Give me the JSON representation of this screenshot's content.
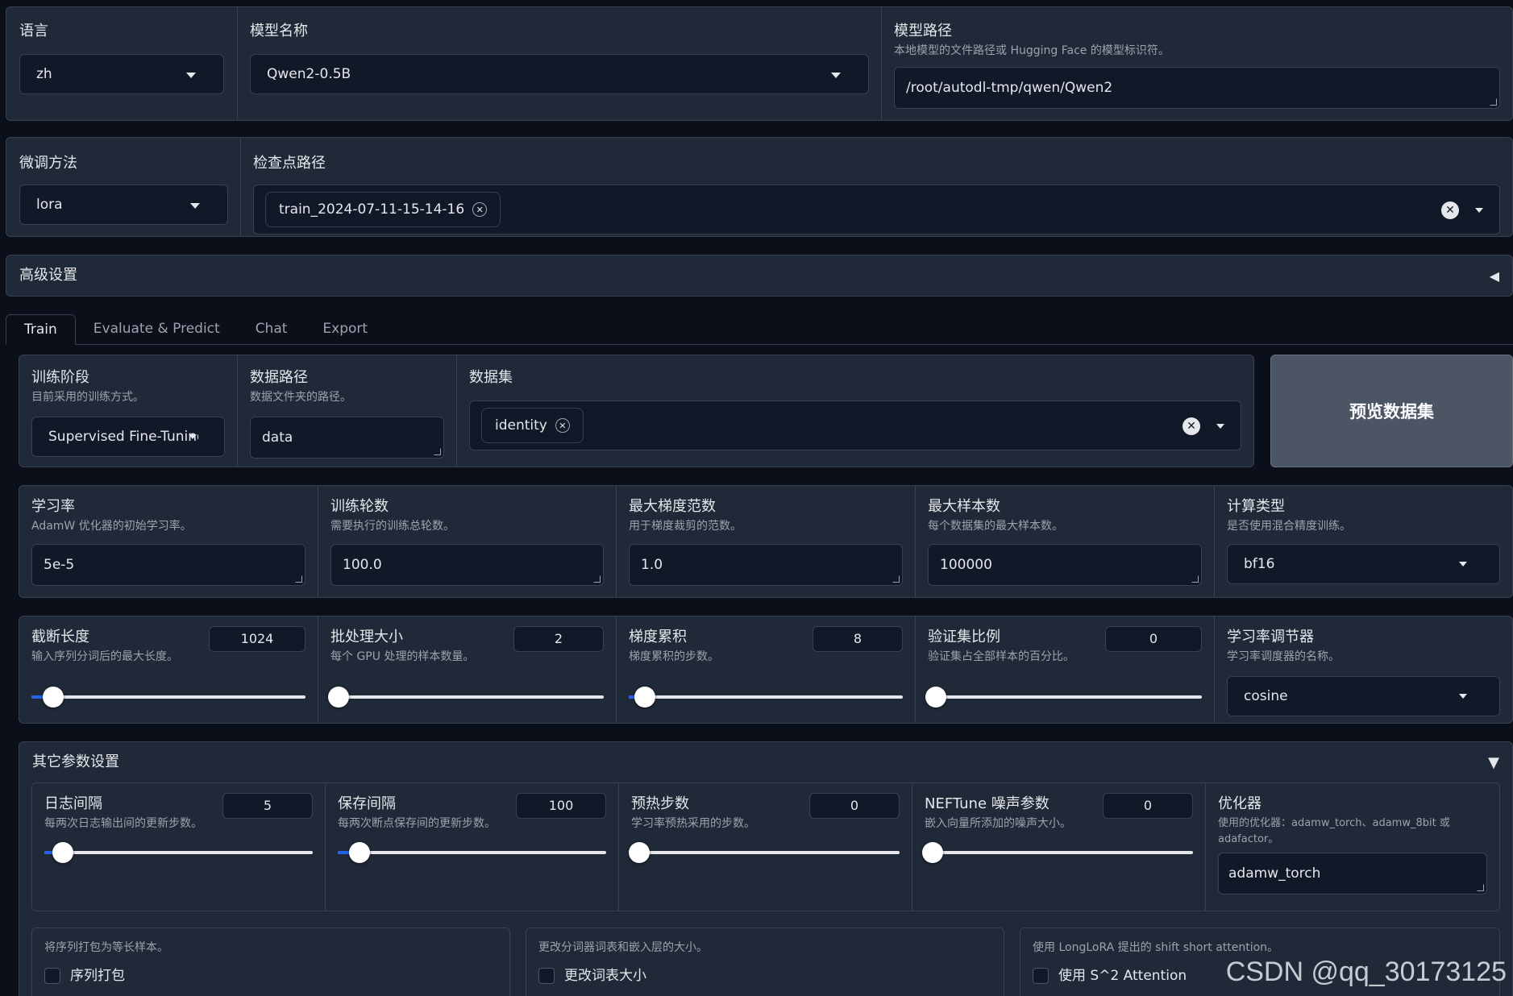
{
  "top": {
    "lang": {
      "label": "语言",
      "value": "zh"
    },
    "model_name": {
      "label": "模型名称",
      "value": "Qwen2-0.5B"
    },
    "model_path": {
      "label": "模型路径",
      "info": "本地模型的文件路径或 Hugging Face 的模型标识符。",
      "value": "/root/autodl-tmp/qwen/Qwen2"
    }
  },
  "second": {
    "finetune": {
      "label": "微调方法",
      "value": "lora"
    },
    "checkpoint": {
      "label": "检查点路径",
      "chip": "train_2024-07-11-15-14-16"
    }
  },
  "advanced": {
    "label": "高级设置",
    "arrow": "◀"
  },
  "tabs": [
    "Train",
    "Evaluate & Predict",
    "Chat",
    "Export"
  ],
  "train": {
    "stage": {
      "label": "训练阶段",
      "info": "目前采用的训练方式。",
      "value": "Supervised Fine-Tuning"
    },
    "data_path": {
      "label": "数据路径",
      "info": "数据文件夹的路径。",
      "value": "data"
    },
    "dataset": {
      "label": "数据集",
      "chip": "identity"
    },
    "preview_button": "预览数据集",
    "lr": {
      "label": "学习率",
      "info": "AdamW 优化器的初始学习率。",
      "value": "5e-5"
    },
    "epochs": {
      "label": "训练轮数",
      "info": "需要执行的训练总轮数。",
      "value": "100.0"
    },
    "max_grad": {
      "label": "最大梯度范数",
      "info": "用于梯度裁剪的范数。",
      "value": "1.0"
    },
    "max_samples": {
      "label": "最大样本数",
      "info": "每个数据集的最大样本数。",
      "value": "100000"
    },
    "compute_type": {
      "label": "计算类型",
      "info": "是否使用混合精度训练。",
      "value": "bf16"
    },
    "cutoff": {
      "label": "截断长度",
      "info": "输入序列分词后的最大长度。",
      "value": "1024",
      "fraction": 0.05
    },
    "batch": {
      "label": "批处理大小",
      "info": "每个 GPU 处理的样本数量。",
      "value": "2",
      "fraction": 0.0
    },
    "grad_acc": {
      "label": "梯度累积",
      "info": "梯度累积的步数。",
      "value": "8",
      "fraction": 0.03
    },
    "val_ratio": {
      "label": "验证集比例",
      "info": "验证集占全部样本的百分比。",
      "value": "0",
      "fraction": 0.0
    },
    "scheduler": {
      "label": "学习率调节器",
      "info": "学习率调度器的名称。",
      "value": "cosine"
    }
  },
  "other": {
    "label": "其它参数设置",
    "arrow": "▼",
    "log_steps": {
      "label": "日志间隔",
      "info": "每两次日志输出间的更新步数。",
      "value": "5",
      "fraction": 0.04
    },
    "save_steps": {
      "label": "保存间隔",
      "info": "每两次断点保存间的更新步数。",
      "value": "100",
      "fraction": 0.05
    },
    "warmup": {
      "label": "预热步数",
      "info": "学习率预热采用的步数。",
      "value": "0",
      "fraction": 0.0
    },
    "neftune": {
      "label": "NEFTune 噪声参数",
      "info": "嵌入向量所添加的噪声大小。",
      "value": "0",
      "fraction": 0.0
    },
    "optim": {
      "label": "优化器",
      "info": "使用的优化器：adamw_torch、adamw_8bit 或 adafactor。",
      "value": "adamw_torch"
    },
    "packing": {
      "info": "将序列打包为等长样本。",
      "label": "序列打包"
    },
    "resize_vocab": {
      "info": "更改分词器词表和嵌入层的大小。",
      "label": "更改词表大小"
    },
    "s2attn": {
      "info": "使用 LongLoRA 提出的 shift short attention。",
      "label": "使用 S^2 Attention"
    }
  },
  "watermark": "CSDN @qq_30173125"
}
